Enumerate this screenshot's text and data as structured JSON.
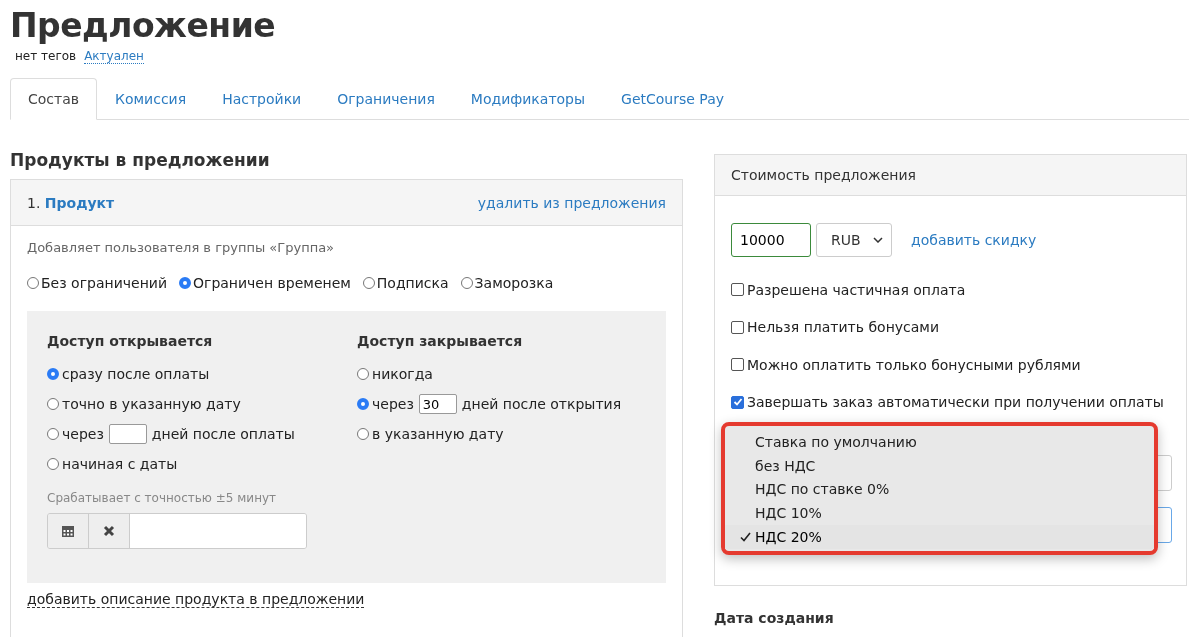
{
  "page": {
    "title": "Предложение",
    "tags": "нет тегов",
    "status": "Актуален"
  },
  "tabs": [
    {
      "label": "Состав",
      "selected": true
    },
    {
      "label": "Комиссия",
      "selected": false
    },
    {
      "label": "Настройки",
      "selected": false
    },
    {
      "label": "Ограничения",
      "selected": false
    },
    {
      "label": "Модификаторы",
      "selected": false
    },
    {
      "label": "GetCourse Pay",
      "selected": false
    }
  ],
  "products": {
    "heading": "Продукты в предложении",
    "item": {
      "number": "1.",
      "name": "Продукт",
      "remove": "удалить из предложения",
      "description": "Добавляет пользователя в группы «Группа»",
      "access_types": [
        {
          "label": "Без ограничений",
          "selected": false
        },
        {
          "label": "Ограничен временем",
          "selected": true
        },
        {
          "label": "Подписка",
          "selected": false
        },
        {
          "label": "Заморозка",
          "selected": false
        }
      ],
      "opens": {
        "heading": "Доступ открывается",
        "options": [
          {
            "kind": "plain",
            "label": "сразу после оплаты",
            "selected": true
          },
          {
            "kind": "plain",
            "label": "точно в указанную дату",
            "selected": false
          },
          {
            "kind": "days",
            "label": "через",
            "suffix": "дней после оплаты",
            "selected": false
          },
          {
            "kind": "plain",
            "label": "начиная с даты",
            "selected": false
          }
        ],
        "hint": "Срабатывает с точностью ±5 минут"
      },
      "closes": {
        "heading": "Доступ закрывается",
        "options": [
          {
            "kind": "plain",
            "label": "никогда",
            "selected": false
          },
          {
            "kind": "days",
            "label": "через",
            "value": "30",
            "suffix": "дней после открытия",
            "selected": true
          },
          {
            "kind": "plain",
            "label": "в указанную дату",
            "selected": false
          }
        ]
      },
      "add_description": "добавить описание продукта в предложении"
    }
  },
  "price": {
    "heading": "Стоимость предложения",
    "amount": "10000",
    "currency": "RUB",
    "add_discount": "добавить скидку",
    "options": [
      {
        "label": "Разрешена частичная оплата",
        "checked": false
      },
      {
        "label": "Нельзя платить бонусами",
        "checked": false
      },
      {
        "label": "Можно оплатить только бонусными рублями",
        "checked": false
      },
      {
        "label": "Завершать заказ автоматически при получении оплаты",
        "checked": true
      }
    ],
    "vat_menu": [
      {
        "label": "Ставка по умолчанию",
        "selected": false
      },
      {
        "label": "без НДС",
        "selected": false
      },
      {
        "label": "НДС по ставке 0%",
        "selected": false
      },
      {
        "label": "НДС 10%",
        "selected": false
      },
      {
        "label": "НДС 20%",
        "selected": true
      }
    ]
  },
  "created": {
    "heading": "Дата создания"
  }
}
